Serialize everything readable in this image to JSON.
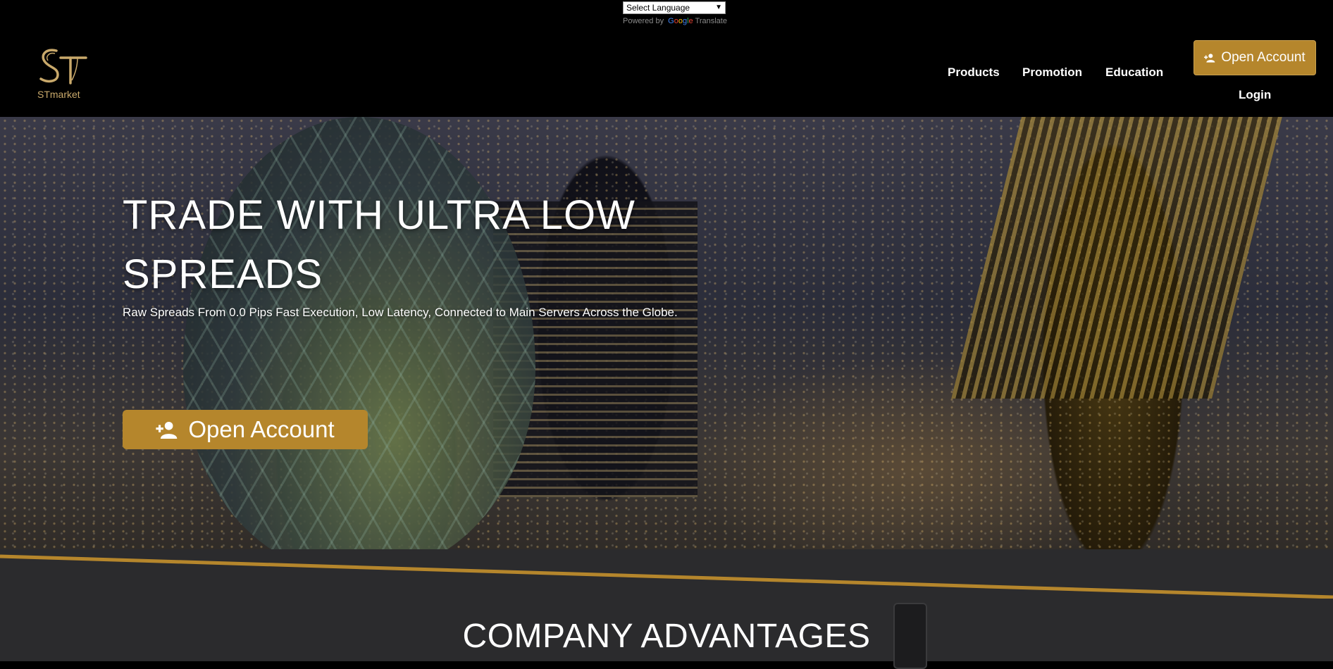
{
  "translate": {
    "select_label": "Select Language",
    "powered_by": "Powered by",
    "google": [
      "G",
      "o",
      "o",
      "g",
      "l",
      "e"
    ],
    "translate_word": "Translate"
  },
  "brand": {
    "name": "STmarket",
    "logo_color": "#c9a96b"
  },
  "nav": {
    "items": [
      "Products",
      "Promotion",
      "Education"
    ],
    "open_account": "Open Account",
    "login": "Login"
  },
  "hero": {
    "title_line1": "TRADE WITH ULTRA LOW",
    "title_line2": "SPREADS",
    "subtitle": "Raw Spreads From 0.0 Pips Fast Execution, Low Latency, Connected to Main Servers Across the Globe.",
    "cta": "Open Account"
  },
  "section": {
    "title": "COMPANY ADVANTAGES"
  },
  "colors": {
    "accent": "#b5862c",
    "header_bg": "#000000",
    "section_bg": "#2b2b2d"
  },
  "icons": {
    "add_user": "add-user-icon",
    "dropdown": "dropdown-arrow-icon"
  }
}
